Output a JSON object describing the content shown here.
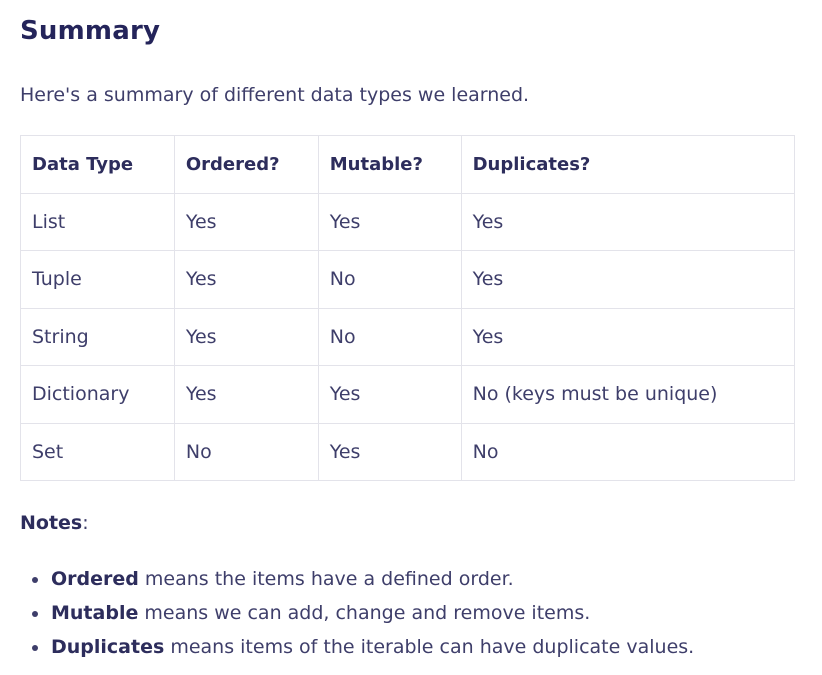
{
  "heading": "Summary",
  "intro": "Here's a summary of different data types we learned.",
  "table": {
    "headers": [
      "Data Type",
      "Ordered?",
      "Mutable?",
      "Duplicates?"
    ],
    "rows": [
      [
        "List",
        "Yes",
        "Yes",
        "Yes"
      ],
      [
        "Tuple",
        "Yes",
        "No",
        "Yes"
      ],
      [
        "String",
        "Yes",
        "No",
        "Yes"
      ],
      [
        "Dictionary",
        "Yes",
        "Yes",
        "No (keys must be unique)"
      ],
      [
        "Set",
        "No",
        "Yes",
        "No"
      ]
    ]
  },
  "notes": {
    "label": "Notes",
    "label_suffix": ":",
    "items": [
      {
        "term": "Ordered",
        "text": " means the items have a defined order."
      },
      {
        "term": "Mutable",
        "text": " means we can add, change and remove items."
      },
      {
        "term": "Duplicates",
        "text": " means items of the iterable can have duplicate values."
      }
    ]
  }
}
